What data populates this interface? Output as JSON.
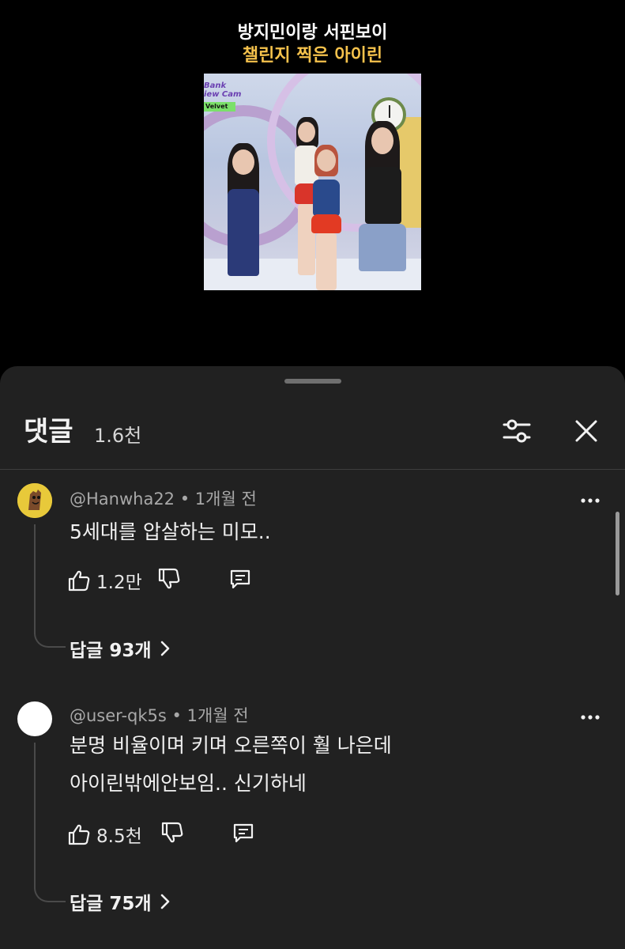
{
  "video": {
    "caption_line1": "방지민이랑 서핀보이",
    "caption_line2": "챌린지 찍은 아이린",
    "thumb_tag_line1": "Bank",
    "thumb_tag_line2": "iew Cam",
    "thumb_tag_line3": "Velvet"
  },
  "comments_panel": {
    "title": "댓글",
    "count": "1.6천",
    "filter_icon": "sliders-icon",
    "close_icon": "close-icon"
  },
  "comments": [
    {
      "author": "@Hanwha22",
      "time": "1개월 전",
      "lines": [
        "5세대를 압살하는 미모.."
      ],
      "likes": "1.2만",
      "replies_label": "답글 93개",
      "avatar_color": "#e8c93a"
    },
    {
      "author": "@user-qk5s",
      "time": "1개월 전",
      "lines": [
        "분명 비율이며 키며 오른쪽이 훨 나은데",
        "아이린밖에안보임.. 신기하네"
      ],
      "likes": "8.5천",
      "replies_label": "답글 75개",
      "avatar_color": "#ffffff"
    }
  ],
  "colors": {
    "panel_bg": "#212121",
    "caption_highlight": "#f5c24c",
    "text_primary": "#f1f1f1",
    "text_secondary": "#a8a8a8"
  }
}
